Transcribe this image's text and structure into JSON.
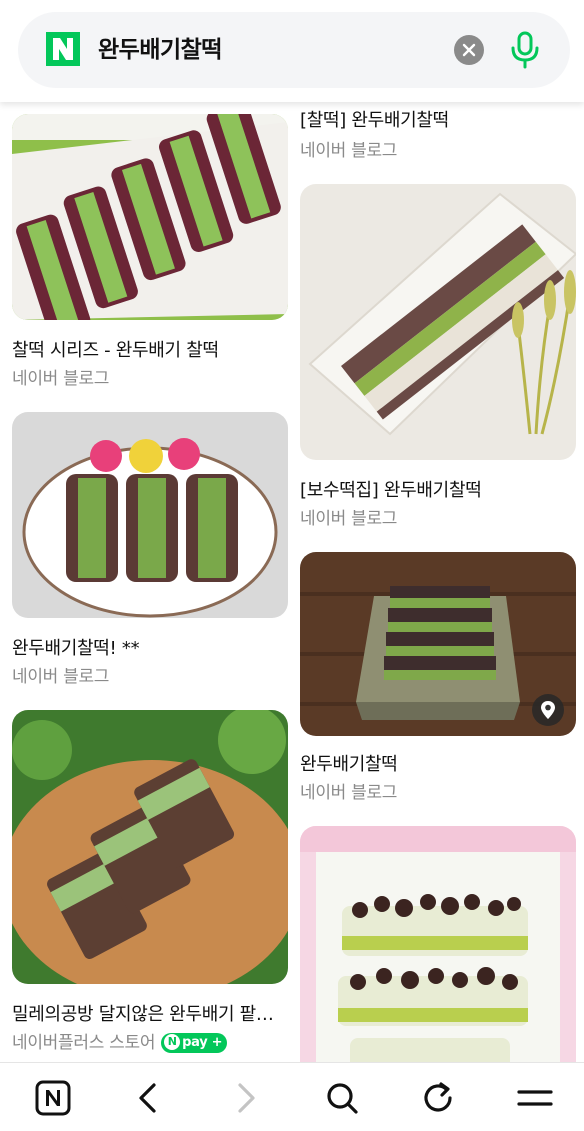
{
  "search": {
    "query": "완두배기찰떡"
  },
  "results": {
    "left": [
      {
        "title": "찰떡 시리즈 - 완두배기 찰떡",
        "source": "네이버 블로그"
      },
      {
        "title": "완두배기찰떡! **",
        "source": "네이버 블로그"
      },
      {
        "title": "밀레의공방 달지않은 완두배기 팥찰떡",
        "source": "네이버플러스 스토어",
        "badge": "pay"
      }
    ],
    "right": [
      {
        "title": "[찰떡] 완두배기찰떡",
        "source": "네이버 블로그"
      },
      {
        "title": "[보수떡집] 완두배기찰떡",
        "source": "네이버 블로그"
      },
      {
        "title": "완두배기찰떡",
        "source": "네이버 블로그"
      }
    ]
  },
  "colors": {
    "brand_green": "#03c75a",
    "source_gray": "#8a8a8a"
  },
  "icons": {
    "logo": "naver-n-icon",
    "clear": "close-icon",
    "voice": "microphone-icon",
    "place": "map-pin-icon",
    "toolbar": [
      "home-n-icon",
      "back-icon",
      "forward-icon",
      "search-icon",
      "refresh-icon",
      "menu-icon"
    ]
  }
}
